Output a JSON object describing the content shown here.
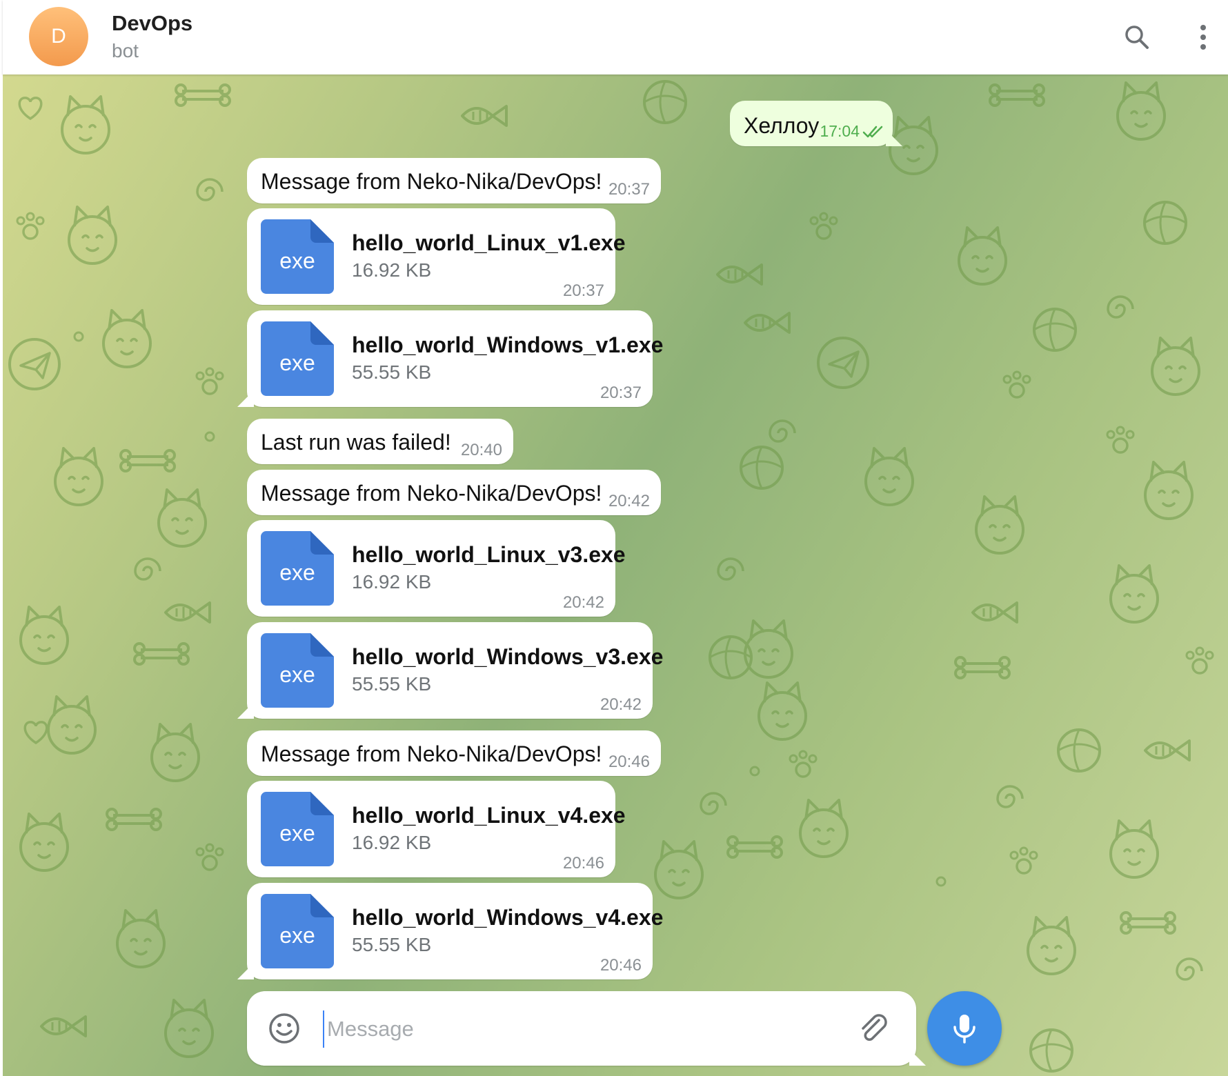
{
  "header": {
    "avatar_letter": "D",
    "title": "DevOps",
    "subtitle": "bot",
    "icons": [
      "search-icon",
      "more-vertical-icon"
    ]
  },
  "colors": {
    "accent": "#3e8ee6",
    "file_icon": "#4a86e0",
    "outgoing_bubble": "#eeffde",
    "outgoing_time": "#4fae4e",
    "avatar": "#f39a4d"
  },
  "messages": [
    {
      "type": "text",
      "direction": "out",
      "text": "Хеллоу",
      "time": "17:04",
      "status": "read"
    },
    {
      "type": "text",
      "direction": "in",
      "text": "Message from Neko-Nika/DevOps!",
      "time": "20:37"
    },
    {
      "type": "file",
      "direction": "in",
      "ext": "exe",
      "name": "hello_world_Linux_v1.exe",
      "size": "16.92 KB",
      "time": "20:37"
    },
    {
      "type": "file",
      "direction": "in",
      "ext": "exe",
      "name": "hello_world_Windows_v1.exe",
      "size": "55.55 KB",
      "time": "20:37"
    },
    {
      "type": "text",
      "direction": "in",
      "text": "Last run was failed!",
      "time": "20:40"
    },
    {
      "type": "text",
      "direction": "in",
      "text": "Message from Neko-Nika/DevOps!",
      "time": "20:42"
    },
    {
      "type": "file",
      "direction": "in",
      "ext": "exe",
      "name": "hello_world_Linux_v3.exe",
      "size": "16.92 KB",
      "time": "20:42"
    },
    {
      "type": "file",
      "direction": "in",
      "ext": "exe",
      "name": "hello_world_Windows_v3.exe",
      "size": "55.55 KB",
      "time": "20:42"
    },
    {
      "type": "text",
      "direction": "in",
      "text": "Message from Neko-Nika/DevOps!",
      "time": "20:46"
    },
    {
      "type": "file",
      "direction": "in",
      "ext": "exe",
      "name": "hello_world_Linux_v4.exe",
      "size": "16.92 KB",
      "time": "20:46"
    },
    {
      "type": "file",
      "direction": "in",
      "ext": "exe",
      "name": "hello_world_Windows_v4.exe",
      "size": "55.55 KB",
      "time": "20:46"
    }
  ],
  "composer": {
    "placeholder": "Message",
    "value": "",
    "icons": [
      "emoji-icon",
      "paperclip-icon",
      "microphone-icon"
    ]
  }
}
